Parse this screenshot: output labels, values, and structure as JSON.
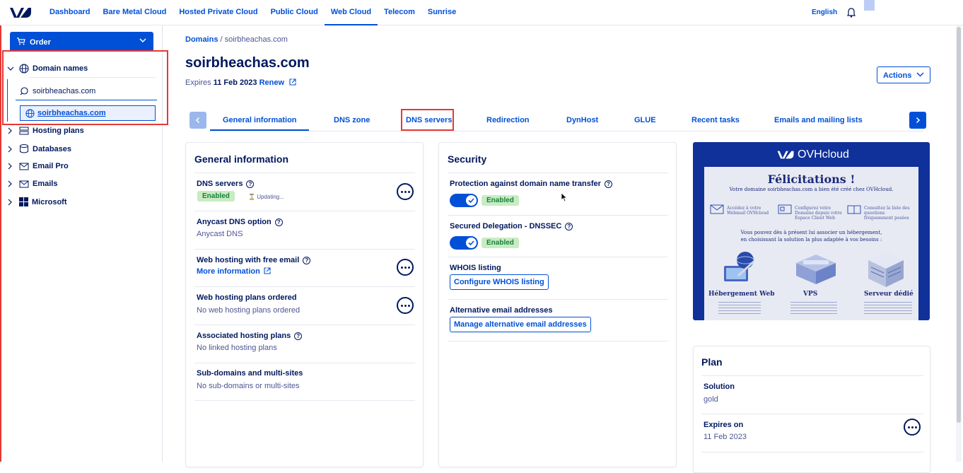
{
  "topnav": {
    "items": [
      "Dashboard",
      "Bare Metal Cloud",
      "Hosted Private Cloud",
      "Public Cloud",
      "Web Cloud",
      "Telecom",
      "Sunrise"
    ],
    "active": "Web Cloud",
    "language": "English"
  },
  "sidebar": {
    "order_label": "Order",
    "domain_names_label": "Domain names",
    "search_value": "soirbheachas.com",
    "selected_domain": "soirbheachas.com",
    "items": [
      "Hosting plans",
      "Databases",
      "Email Pro",
      "Emails",
      "Microsoft"
    ]
  },
  "breadcrumb": {
    "root": "Domains",
    "sep": "/",
    "current": "soirbheachas.com"
  },
  "header": {
    "title": "soirbheachas.com",
    "expires_prefix": "Expires",
    "expires_date": "11 Feb 2023",
    "renew_label": "Renew",
    "actions_label": "Actions"
  },
  "tabs": [
    "General information",
    "DNS zone",
    "DNS servers",
    "Redirection",
    "DynHost",
    "GLUE",
    "Recent tasks",
    "Emails and mailing lists"
  ],
  "general_card": {
    "title": "General information",
    "dns_servers_label": "DNS servers",
    "dns_status": "Enabled",
    "updating": "Updating...",
    "anycast_label": "Anycast DNS option",
    "anycast_value": "Anycast DNS",
    "webhosting_free_label": "Web hosting with free email",
    "more_info": "More information",
    "plans_ordered_label": "Web hosting plans ordered",
    "plans_ordered_value": "No web hosting plans ordered",
    "associated_label": "Associated hosting plans",
    "associated_value": "No linked hosting plans",
    "subdomains_label": "Sub-domains and multi-sites",
    "subdomains_value": "No sub-domains or multi-sites"
  },
  "security_card": {
    "title": "Security",
    "transfer_label": "Protection against domain name transfer",
    "transfer_status": "Enabled",
    "dnssec_label": "Secured Delegation - DNSSEC",
    "dnssec_status": "Enabled",
    "whois_label": "WHOIS listing",
    "whois_btn": "Configure WHOIS listing",
    "alt_email_label": "Alternative email addresses",
    "alt_email_btn": "Manage alternative email addresses"
  },
  "ad": {
    "brand": "OVHcloud",
    "headline": "Félicitations !",
    "subline": "Votre domaine soirbheachas.com a bien été créé chez OVHcloud.",
    "links": [
      "Accédez à votre Webmail OVHcloud",
      "Configurez votre Domaine depuis votre Espace Client Web",
      "Consultez la liste des questions fréquemment posées"
    ],
    "mid_line1": "Vous pouvez dès à présent lui associer un hébergement,",
    "mid_line2": "en choisissant la solution la plus adaptée à vos besoins :",
    "offers": [
      "Hébergement Web",
      "VPS",
      "Serveur dédié"
    ]
  },
  "plan_card": {
    "title": "Plan",
    "solution_label": "Solution",
    "solution_value": "gold",
    "expires_label": "Expires on",
    "expires_value": "11 Feb 2023"
  },
  "colors": {
    "accent": "#0050d7",
    "text": "#00185e",
    "success_bg": "#c8ecc2",
    "highlight": "#e53935"
  }
}
